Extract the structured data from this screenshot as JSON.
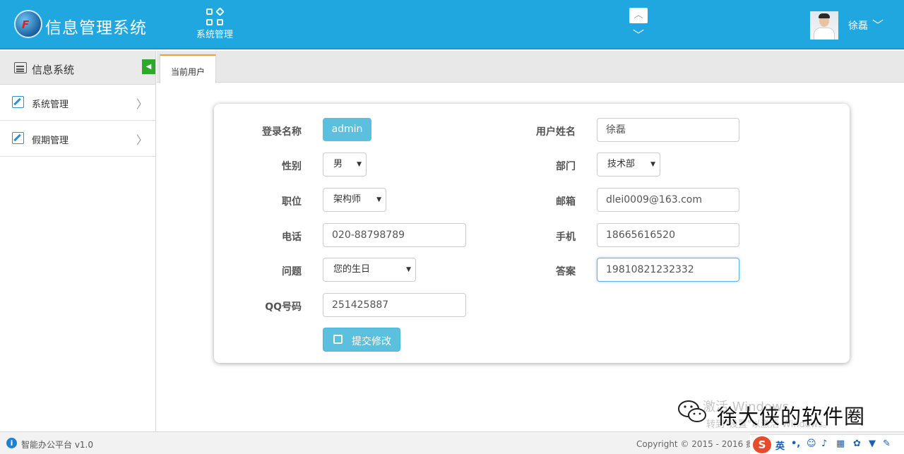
{
  "header": {
    "app_title": "信息管理系统",
    "nav_item_label": "系统管理",
    "user_name": "徐磊"
  },
  "sidebar": {
    "title": "信息系统",
    "items": [
      {
        "label": "系统管理"
      },
      {
        "label": "假期管理"
      }
    ]
  },
  "tabs": [
    {
      "label": "当前用户"
    }
  ],
  "form": {
    "login_name_label": "登录名称",
    "login_name_value": "admin",
    "full_name_label": "用户姓名",
    "full_name_value": "徐磊",
    "gender_label": "性别",
    "gender_value": "男",
    "department_label": "部门",
    "department_value": "技术部",
    "position_label": "职位",
    "position_value": "架构师",
    "email_label": "邮箱",
    "email_value": "dlei0009@163.com",
    "phone_label": "电话",
    "phone_value": "020-88798789",
    "mobile_label": "手机",
    "mobile_value": "18665616520",
    "question_label": "问题",
    "question_value": "您的生日",
    "answer_label": "答案",
    "answer_value": "19810821232332",
    "qq_label": "QQ号码",
    "qq_value": "251425887",
    "submit_label": "提交修改"
  },
  "footer": {
    "platform": "智能办公平台 v1.0",
    "copyright": "Copyright © 2015 - 2016 疯"
  },
  "watermark": {
    "text": "徐大侠的软件圈",
    "activate": "激活 Windows",
    "activate_hint": "转到\"设置\"以激活 Windows。"
  },
  "ime": {
    "logo": "S",
    "mode": "英"
  },
  "colors": {
    "header_bg": "#21a7e0",
    "accent_info": "#5bc0de",
    "tab_top": "#f0a030",
    "toggle_green": "#2ea82a"
  }
}
